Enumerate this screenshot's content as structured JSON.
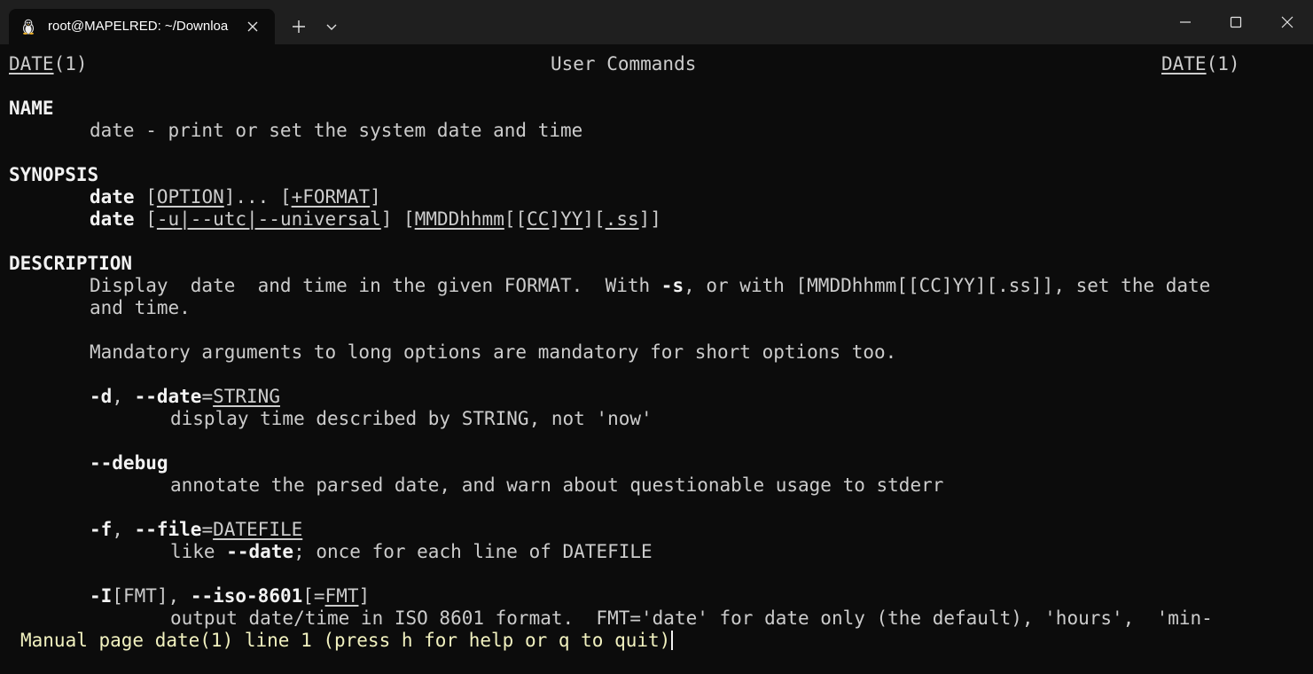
{
  "window": {
    "tab_title": "root@MAPELRED: ~/Downloa",
    "tab_icon": "linux-tux-icon",
    "buttons": {
      "new_tab": "plus-icon",
      "dropdown": "chevron-down-icon",
      "minimize": "minimize-icon",
      "maximize": "maximize-icon",
      "close": "close-icon"
    }
  },
  "man": {
    "header": {
      "left": "DATE",
      "left_suffix": "(1)",
      "center": "User Commands",
      "right": "DATE",
      "right_suffix": "(1)"
    },
    "name_heading": "NAME",
    "name_text": "date - print or set the system date and time",
    "synopsis_heading": "SYNOPSIS",
    "synopsis": {
      "line1": {
        "cmd": "date",
        "sp1": " [",
        "option": "OPTION",
        "sp2": "]... [",
        "format": "+FORMAT",
        "sp3": "]"
      },
      "line2": {
        "cmd": "date",
        "sp1": " [",
        "utc": "-u|--utc|--universal",
        "sp2": "] [",
        "mmdd": "MMDDhhmm",
        "sp3": "[[",
        "cc": "CC",
        "sp4": "]",
        "yy": "YY",
        "sp5": "][",
        "ss": ".ss",
        "sp6": "]]"
      }
    },
    "description_heading": "DESCRIPTION",
    "description": {
      "para1_line1_a": "Display  date  and time in the given FORMAT.  With ",
      "para1_line1_opt": "-s",
      "para1_line1_b": ", or with [MMDDhhmm[[CC]YY][.ss]], set the date",
      "para1_line2": "and time.",
      "para2": "Mandatory arguments to long options are mandatory for short options too."
    },
    "options": [
      {
        "flag_short": "-d",
        "sep": ", ",
        "flag_long": "--date",
        "eq": "=",
        "arg": "STRING",
        "desc_a": "display time described by STRING, not 'now'"
      },
      {
        "flag_long": "--debug",
        "desc_a": "annotate the parsed date, and warn about questionable usage to stderr"
      },
      {
        "flag_short": "-f",
        "sep": ", ",
        "flag_long": "--file",
        "eq": "=",
        "arg": "DATEFILE",
        "desc_a": "like ",
        "desc_opt": "--date",
        "desc_b": "; once for each line of DATEFILE"
      },
      {
        "flag_short": "-I",
        "flag_short_rest": "[FMT]",
        "sep": ", ",
        "flag_long": "--iso-8601",
        "bracket_open": "[=",
        "arg": "FMT",
        "bracket_close": "]",
        "desc_a": "output date/time in ISO 8601 format.  FMT='date' for date only (the default), 'hours',  'min-"
      }
    ],
    "status_line": "Manual page date(1) line 1 (press h for help or q to quit)"
  }
}
